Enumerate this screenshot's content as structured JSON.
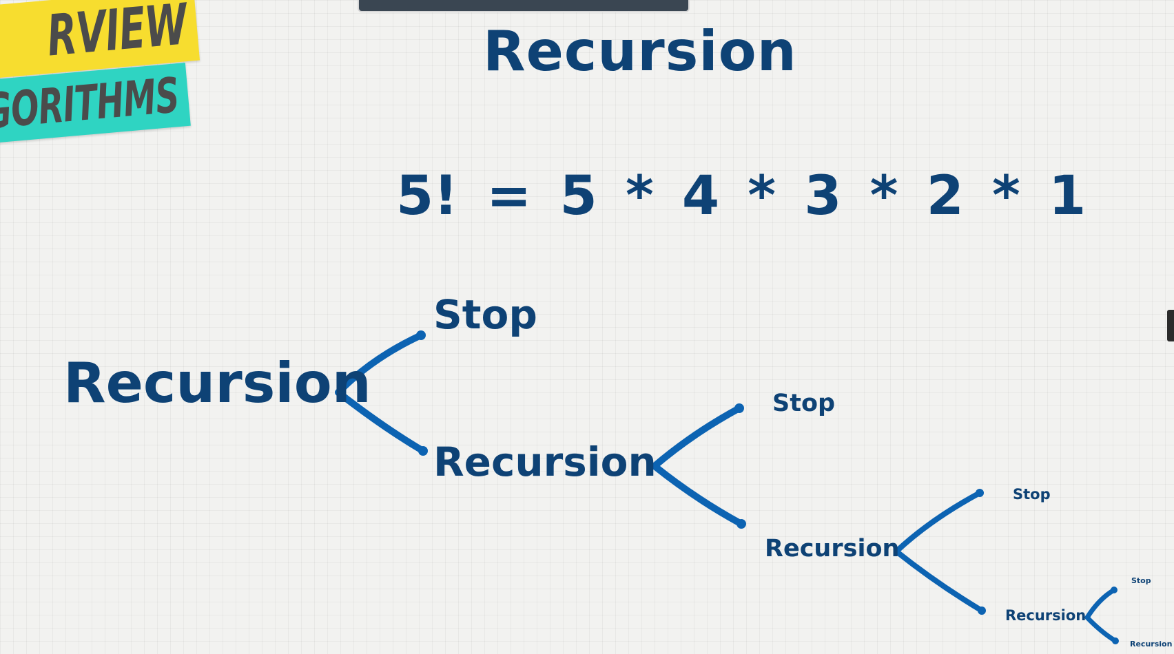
{
  "banner": {
    "line1": "RVIEW",
    "line2": "GORITHMS"
  },
  "slide": {
    "title": "Recursion",
    "formula": "5! = 5 * 4 * 3 * 2 * 1"
  },
  "tree": {
    "levels": [
      {
        "node": "Recursion",
        "stop": "Stop",
        "recurse": "Recursion"
      },
      {
        "node": "Recursion",
        "stop": "Stop",
        "recurse": "Recursion"
      },
      {
        "node": "Recursion",
        "stop": "Stop",
        "recurse": "Recursion"
      },
      {
        "node": "Recursion",
        "stop": "Stop",
        "recurse": "Recursion"
      }
    ]
  },
  "colors": {
    "text": "#0e4275",
    "branch": "#0c63b2",
    "banner_yellow": "#f7dd2f",
    "banner_teal": "#2fd4c2"
  }
}
